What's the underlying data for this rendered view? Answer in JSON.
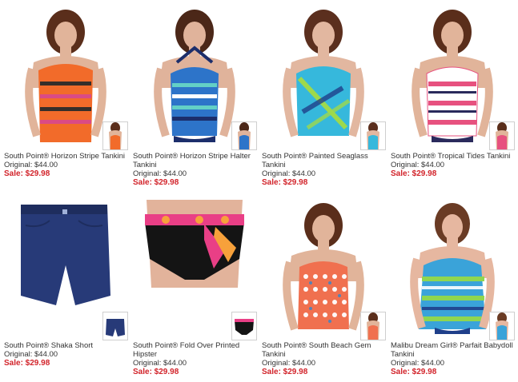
{
  "products": [
    {
      "name": "South Point® Horizon Stripe Tankini",
      "original": "Original: $44.00",
      "sale": "Sale: $29.98",
      "colors": {
        "top": "#f26b2a",
        "stripe": "#2b2b2b",
        "accent": "#d94a8a"
      }
    },
    {
      "name": "South Point® Horizon Stripe Halter Tankini",
      "original": "Original: $44.00",
      "sale": "Sale: $29.98",
      "colors": {
        "top": "#2d74c9",
        "stripe": "#63d0c6",
        "accent": "#1c2e6b"
      }
    },
    {
      "name": "South Point® Painted Seaglass Tankini",
      "original": "Original: $44.00",
      "sale": "Sale: $29.98",
      "colors": {
        "top": "#36b8dc",
        "stripe": "#9ed94c",
        "accent": "#1f3f8a"
      }
    },
    {
      "name": "South Point® Tropical Tides Tankini",
      "original": "Original: $44.00",
      "sale": "Sale: $29.98",
      "colors": {
        "top": "#e7517f",
        "stripe": "#ffffff",
        "accent": "#2a2a5c"
      }
    },
    {
      "name": "South Point® Shaka Short",
      "original": "Original: $44.00",
      "sale": "Sale: $29.98",
      "colors": {
        "top": "#273a78",
        "stripe": "#1e2d5e",
        "accent": "#273a78"
      }
    },
    {
      "name": "South Point® Fold Over Printed Hipster",
      "original": "Original: $44.00",
      "sale": "Sale: $29.98",
      "colors": {
        "top": "#141414",
        "stripe": "#e93f86",
        "accent": "#f7a13b"
      }
    },
    {
      "name": "South Point® South Beach Gem Tankini",
      "original": "Original: $44.00",
      "sale": "Sale: $29.98",
      "colors": {
        "top": "#f0704f",
        "stripe": "#ffffff",
        "accent": "#3a86c9"
      }
    },
    {
      "name": "Malibu Dream Girl® Parfait Babydoll Tankini",
      "original": "Original: $44.00",
      "sale": "Sale: $29.98",
      "colors": {
        "top": "#3aa3d9",
        "stripe": "#8fd650",
        "accent": "#1f3f8a"
      }
    }
  ]
}
